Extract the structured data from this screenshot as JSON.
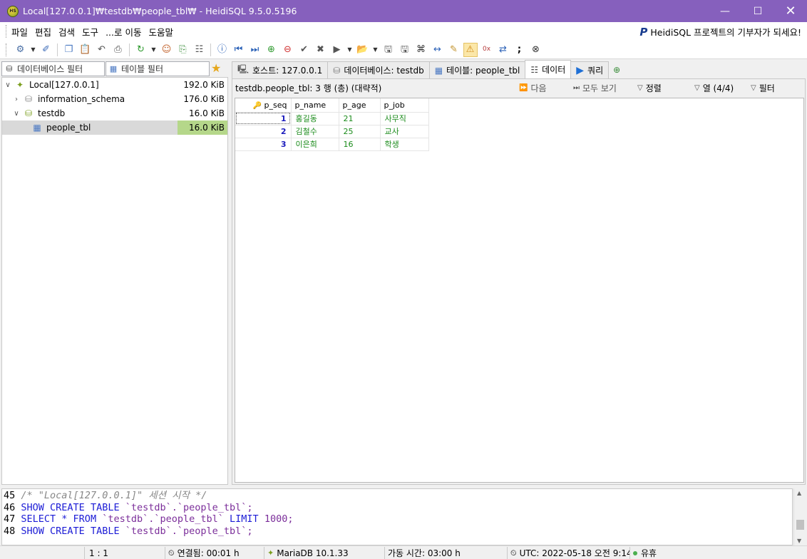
{
  "window": {
    "title": "Local[127.0.0.1]₩testdb₩people_tbl₩ - HeidiSQL 9.5.0.5196",
    "app_icon_text": "HS"
  },
  "menu": {
    "items": [
      "파일",
      "편집",
      "검색",
      "도구",
      "...로 이동",
      "도움말"
    ],
    "donate": "HeidiSQL 프로젝트의 기부자가 되세요!"
  },
  "filters": {
    "db_filter": "데이터베이스 필터",
    "table_filter": "테이블 필터"
  },
  "tree": {
    "nodes": [
      {
        "label": "Local[127.0.0.1]",
        "size": "192.0 KiB"
      },
      {
        "label": "information_schema",
        "size": "176.0 KiB"
      },
      {
        "label": "testdb",
        "size": "16.0 KiB"
      },
      {
        "label": "people_tbl",
        "size": "16.0 KiB"
      }
    ]
  },
  "tabs": [
    {
      "label": "호스트: 127.0.0.1",
      "icon": "host-icon"
    },
    {
      "label": "데이터베이스: testdb",
      "icon": "database-icon"
    },
    {
      "label": "테이블: people_tbl",
      "icon": "table-icon"
    },
    {
      "label": "데이터",
      "icon": "data-icon"
    },
    {
      "label": "쿼리",
      "icon": "play-icon"
    }
  ],
  "data_view": {
    "info": "testdb.people_tbl: 3 행 (총) (대략적)",
    "next": "다음",
    "show_all": "모두 보기",
    "sort": "정렬",
    "columns": "열 (4/4)",
    "filter": "필터"
  },
  "grid": {
    "headers": [
      "p_seq",
      "p_name",
      "p_age",
      "p_job"
    ],
    "rows": [
      [
        "1",
        "홍길동",
        "21",
        "사무직"
      ],
      [
        "2",
        "김철수",
        "25",
        "교사"
      ],
      [
        "3",
        "이은희",
        "16",
        "학생"
      ]
    ]
  },
  "sql_log": {
    "lines": [
      {
        "num": "45",
        "text": "/* \"Local[127.0.0.1]\" 세션 시작 */"
      },
      {
        "num": "46",
        "kw": "SHOW CREATE TABLE",
        "rest": "`testdb`.`people_tbl`;"
      },
      {
        "num": "47",
        "kw": "SELECT * FROM",
        "rest": "`testdb`.`people_tbl`",
        "kw2": "LIMIT",
        "n": "1000;"
      },
      {
        "num": "48",
        "kw": "SHOW CREATE TABLE",
        "rest": "`testdb`.`people_tbl`;"
      }
    ]
  },
  "status": {
    "position": "1 : 1",
    "connected": "연결됨: 00:01 h",
    "server": "MariaDB 10.1.33",
    "uptime": "가동 시간: 03:00 h",
    "utc": "UTC: 2022-05-18 오전 9:14",
    "idle": "유휴"
  }
}
